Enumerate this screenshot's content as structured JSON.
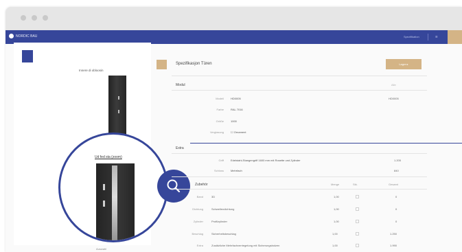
{
  "app": {
    "brand": "NORDIC BAU",
    "nav_link": "Spezifikation",
    "nav_menu": "☰"
  },
  "left": {
    "door_caption": "Innere di obloosin",
    "zoom_caption": "Ud fed sta (zoom)",
    "bottom_caption": "Auswahl"
  },
  "config": {
    "title": "Spezifikasjon Türen",
    "button_label": "Lagre ▸",
    "section1": "Modul",
    "section1_tag": "Alle",
    "section2": "Extra",
    "section3": "Zubehör",
    "rows1": [
      {
        "label": "Modell",
        "value": "HD0005",
        "right": "HD0005"
      },
      {
        "label": "Farbe",
        "value": "RAL 7016",
        "right": ""
      },
      {
        "label": "Größe",
        "value": "1000",
        "right": ""
      },
      {
        "label": "Verglasung",
        "value": "☐ Ornament",
        "right": ""
      }
    ],
    "rows2": [
      {
        "label": "Griff",
        "value": "Edelstahl-Stangengriff 1600 mm mit Rosette und Zylinder",
        "right": "1.205"
      },
      {
        "label": "Schloss",
        "value": "Mehrfach",
        "right": "840"
      }
    ],
    "table_headers": [
      "Menge",
      "Stk.",
      "Gesamt"
    ],
    "table_rows": [
      {
        "label": "Band",
        "name": "3D",
        "qty": "1,00",
        "total": "0"
      },
      {
        "label": "Dichtung",
        "name": "Schwellendichtung",
        "qty": "1,00",
        "total": "0"
      },
      {
        "label": "Zylinder",
        "name": "Profilzylinder",
        "qty": "1,00",
        "total": "0"
      },
      {
        "label": "Beschlag",
        "name": "Sicherheitsbeschlag",
        "qty": "1,00",
        "total": "1.250"
      },
      {
        "label": "Extra",
        "name": "Zusätzliche Mehrfachverriegelung mit Sicherungsbolzen",
        "qty": "1,00",
        "total": "1.990"
      }
    ]
  },
  "colors": {
    "primary": "#36469a",
    "accent": "#d4b486"
  }
}
